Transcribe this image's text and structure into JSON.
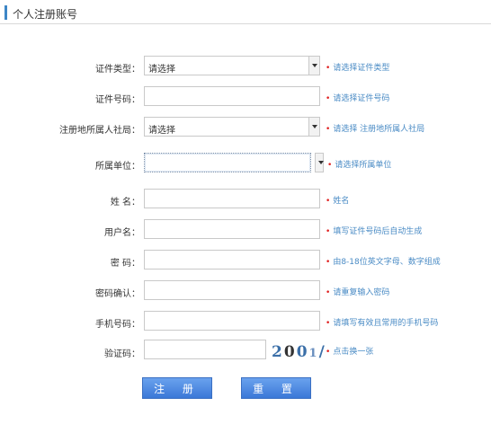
{
  "header": {
    "title": "个人注册账号"
  },
  "form": {
    "id_type": {
      "label": "证件类型：",
      "value": "请选择",
      "hint": "请选择证件类型"
    },
    "id_number": {
      "label": "证件号码：",
      "hint": "请选择证件号码"
    },
    "social_bureau": {
      "label": "注册地所属人社局：",
      "value": "请选择",
      "hint": "请选择 注册地所属人社局"
    },
    "unit": {
      "label": "所属单位：",
      "hint": "请选择所属单位"
    },
    "name": {
      "label": "姓    名：",
      "hint": "姓名"
    },
    "username": {
      "label": "用户名：",
      "hint": "填写证件号码后自动生成"
    },
    "password": {
      "label": "密    码：",
      "hint": "由8-18位英文字母、数字组成"
    },
    "password_confirm": {
      "label": "密码确认：",
      "hint": "请重复输入密码"
    },
    "phone": {
      "label": "手机号码：",
      "hint": "请填写有效且常用的手机号码"
    },
    "captcha": {
      "label": "验证码：",
      "image_text": [
        "2",
        "0",
        "0",
        "1",
        "/"
      ],
      "hint": "点击换一张"
    }
  },
  "buttons": {
    "register": "注 册",
    "reset": "重 置"
  },
  "colors": {
    "accent": "#3d86c6",
    "hint": "#4a8bc5",
    "required_star": "#e02020",
    "button": "#3b78d8"
  }
}
